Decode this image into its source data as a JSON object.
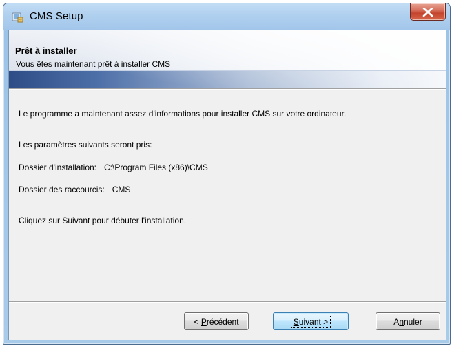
{
  "window": {
    "title": "CMS Setup",
    "close_icon": "close-icon",
    "app_icon": "installer-icon"
  },
  "banner": {
    "title": "Prêt à installer",
    "subtitle": "Vous êtes maintenant prêt à installer CMS"
  },
  "content": {
    "intro": "Le programme a maintenant assez d'informations pour installer CMS sur votre ordinateur.",
    "settings_heading": "Les paramètres suivants seront pris:",
    "install_folder_label": "Dossier d'installation:",
    "install_folder_value": "C:\\Program Files (x86)\\CMS",
    "shortcuts_label": "Dossier des raccourcis:",
    "shortcuts_value": "CMS",
    "instruction": "Cliquez sur Suivant pour débuter l'installation."
  },
  "buttons": {
    "back": {
      "prefix": "< ",
      "mnemonic": "P",
      "rest": "récédent"
    },
    "next": {
      "mnemonic": "S",
      "rest": "uivant >"
    },
    "cancel": {
      "prefix": "A",
      "mnemonic": "n",
      "rest": "nuler"
    }
  },
  "colors": {
    "banner_dark": "#2e4d86",
    "default_button_border": "#3c7fb1",
    "close_button": "#c3432c"
  }
}
